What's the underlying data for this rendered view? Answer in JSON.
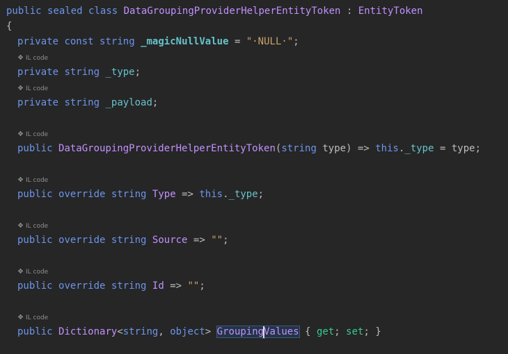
{
  "code": {
    "class_decl": {
      "mod1": "public",
      "mod2": "sealed",
      "kw_class": "class",
      "name": "DataGroupingProviderHelperEntityToken",
      "colon": ":",
      "base": "EntityToken"
    },
    "open_brace": "{",
    "hint_label": "IL code",
    "hint_glyph": "❖",
    "line1": {
      "a": "private",
      "b": "const",
      "c": "string",
      "name": "_magicNullValue",
      "eq": "=",
      "val": "\"·NULL·\"",
      "end": ";"
    },
    "line2": {
      "a": "private",
      "b": "string",
      "name": "_type",
      "end": ";"
    },
    "line3": {
      "a": "private",
      "b": "string",
      "name": "_payload",
      "end": ";"
    },
    "line4": {
      "a": "public",
      "name": "DataGroupingProviderHelperEntityToken",
      "p1": "(",
      "ptype": "string",
      "pname": "type",
      "p2": ")",
      "arrow": "=>",
      "this": "this",
      "dot": ".",
      "field": "_type",
      "eq": "=",
      "rhs": "type",
      "end": ";"
    },
    "line5": {
      "a": "public",
      "b": "override",
      "c": "string",
      "name": "Type",
      "arrow": "=>",
      "this": "this",
      "dot": ".",
      "field": "_type",
      "end": ";"
    },
    "line6": {
      "a": "public",
      "b": "override",
      "c": "string",
      "name": "Source",
      "arrow": "=>",
      "val": "\"\"",
      "end": ";"
    },
    "line7": {
      "a": "public",
      "b": "override",
      "c": "string",
      "name": "Id",
      "arrow": "=>",
      "val": "\"\"",
      "end": ";"
    },
    "line8": {
      "a": "public",
      "type": "Dictionary",
      "lt": "<",
      "t1": "string",
      "comma": ",",
      "t2": "object",
      "gt": ">",
      "name_a": "Grouping",
      "name_b": "Values",
      "ob": "{",
      "get": "get",
      "semi1": ";",
      "set": "set",
      "semi2": ";",
      "cb": "}"
    }
  }
}
